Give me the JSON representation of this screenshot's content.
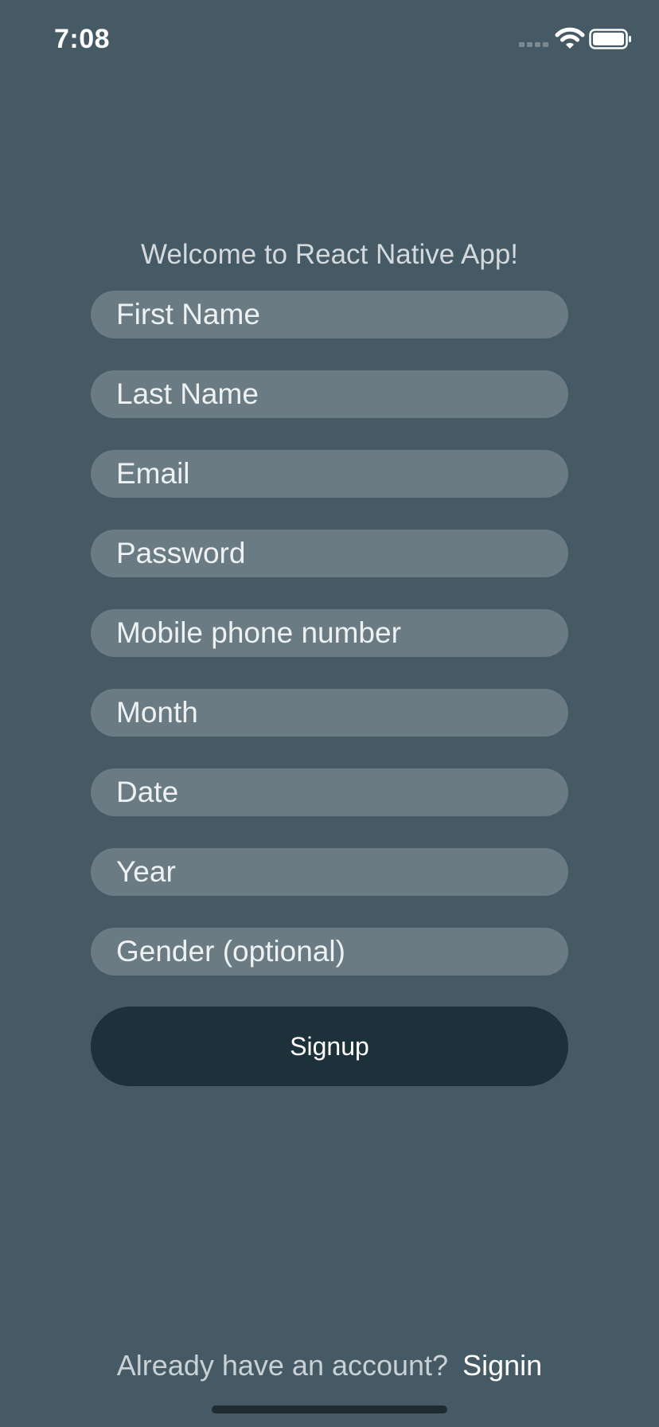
{
  "status_bar": {
    "time": "7:08",
    "icons": [
      "signal-icon",
      "wifi-icon",
      "battery-icon"
    ]
  },
  "welcome_text": "Welcome to React Native App!",
  "form": {
    "fields": [
      {
        "name": "first-name",
        "placeholder": "First Name",
        "value": ""
      },
      {
        "name": "last-name",
        "placeholder": "Last Name",
        "value": ""
      },
      {
        "name": "email",
        "placeholder": "Email",
        "value": ""
      },
      {
        "name": "password",
        "placeholder": "Password",
        "value": ""
      },
      {
        "name": "mobile-phone",
        "placeholder": "Mobile phone number",
        "value": ""
      },
      {
        "name": "month",
        "placeholder": "Month",
        "value": ""
      },
      {
        "name": "date",
        "placeholder": "Date",
        "value": ""
      },
      {
        "name": "year",
        "placeholder": "Year",
        "value": ""
      },
      {
        "name": "gender",
        "placeholder": "Gender (optional)",
        "value": ""
      }
    ],
    "signup_label": "Signup"
  },
  "footer": {
    "prompt": "Already have an account?",
    "signin_label": "Signin"
  },
  "colors": {
    "background": "#455a64",
    "input_background": "#6a7b83",
    "button_background": "#1c313a",
    "text_light": "#ffffff"
  }
}
